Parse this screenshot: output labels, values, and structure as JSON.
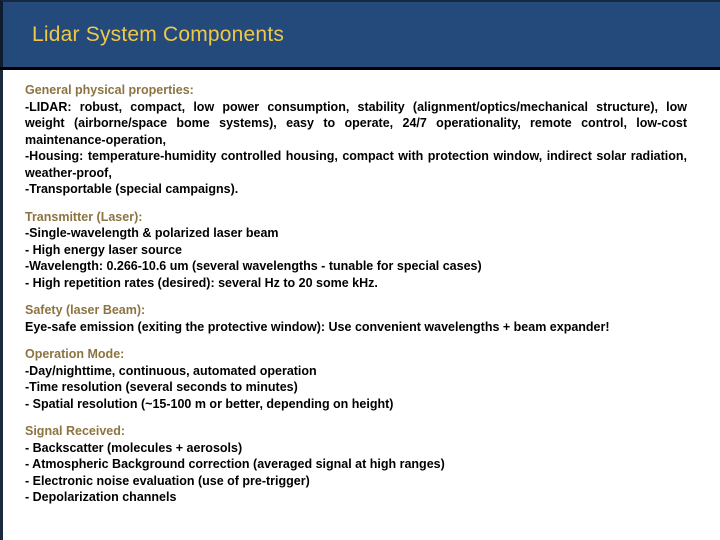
{
  "slide": {
    "title": "Lidar System Components",
    "colors": {
      "title_bar_bg": "#234A7B",
      "title_text": "#EFC84A",
      "section_heading": "#8C7440",
      "body_text": "#000000",
      "page_bg": "#FFFFFF"
    },
    "sections": [
      {
        "heading": "General physical properties:",
        "lines": [
          "-LIDAR: robust, compact, low power consumption, stability (alignment/optics/mechanical structure), low weight (airborne/space bome systems), easy to operate, 24/7 operationality, remote control, low-cost maintenance-operation,",
          "-Housing: temperature-humidity controlled housing, compact with protection window, indirect solar radiation, weather-proof,",
          "-Transportable (special campaigns)."
        ]
      },
      {
        "heading": "Transmitter (Laser):",
        "lines": [
          "-Single-wavelength & polarized laser beam",
          "- High energy laser source",
          "-Wavelength: 0.266-10.6 um (several wavelengths - tunable for special cases)",
          "- High repetition rates (desired): several Hz to 20 some kHz."
        ]
      },
      {
        "heading": "Safety (laser Beam):",
        "lines": [
          "Eye-safe emission (exiting the protective window): Use convenient wavelengths + beam expander!"
        ]
      },
      {
        "heading": "Operation Mode:",
        "lines": [
          "-Day/nighttime, continuous, automated operation",
          "-Time resolution (several seconds to minutes)",
          "- Spatial resolution (~15-100 m or better, depending on height)"
        ]
      },
      {
        "heading": "Signal Received:",
        "lines": [
          "- Backscatter (molecules + aerosols)",
          "- Atmospheric Background correction (averaged signal at high ranges)",
          "- Electronic noise evaluation (use of pre-trigger)",
          "- Depolarization channels"
        ]
      }
    ]
  }
}
